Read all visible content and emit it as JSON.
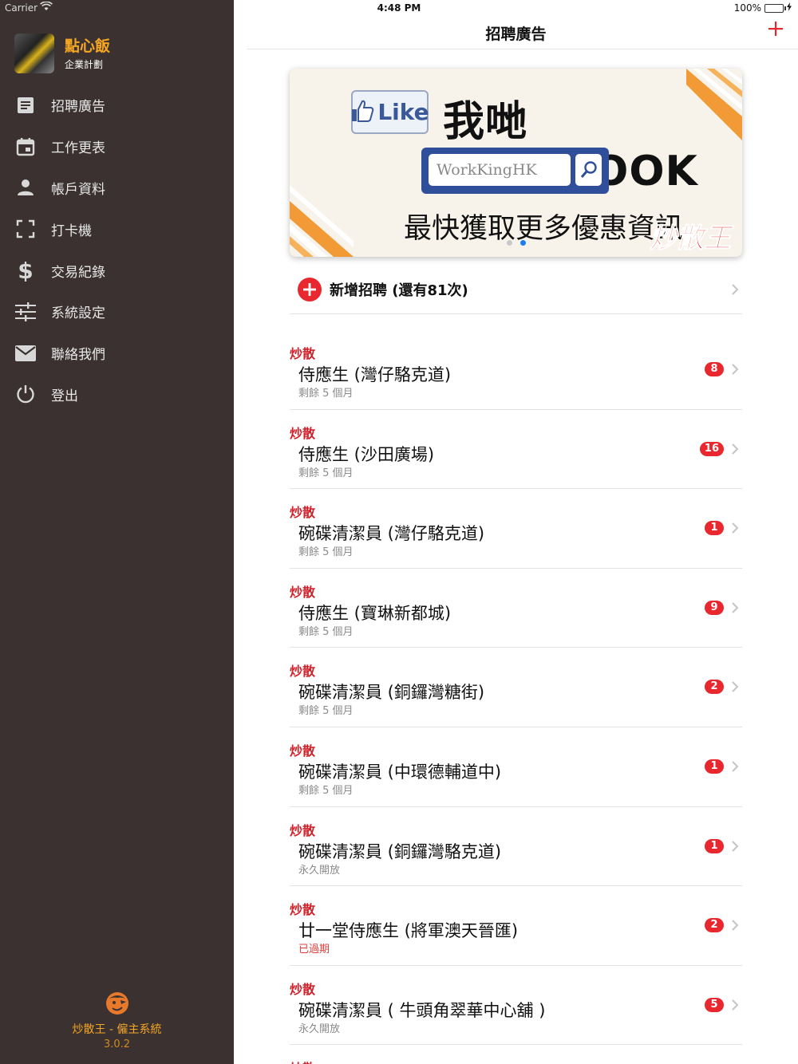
{
  "status_bar": {
    "carrier": "Carrier",
    "time": "4:48 PM",
    "battery": "100%",
    "battery_level": 1.0
  },
  "sidebar": {
    "profile": {
      "name": "點心飯",
      "plan": "企業計劃"
    },
    "items": [
      {
        "label": "招聘廣告",
        "icon": "document-icon"
      },
      {
        "label": "工作更表",
        "icon": "calendar-icon"
      },
      {
        "label": "帳戶資料",
        "icon": "user-icon"
      },
      {
        "label": "打卡機",
        "icon": "scan-icon"
      },
      {
        "label": "交易紀錄",
        "icon": "dollar-icon"
      },
      {
        "label": "系統設定",
        "icon": "sliders-icon"
      },
      {
        "label": "聯絡我們",
        "icon": "mail-icon"
      },
      {
        "label": "登出",
        "icon": "power-icon"
      }
    ],
    "brand": {
      "name": "炒散王 - 僱主系統",
      "version": "3.0.2"
    }
  },
  "navbar": {
    "title": "招聘廣告",
    "add_icon": "plus-icon"
  },
  "banner": {
    "like_label": "Like",
    "headline": "我哋 FACEBOOK",
    "search_text": "WorkKingHK",
    "slogan": "最快獲取更多優惠資訊",
    "logo_text": "炒散王",
    "page_count": 2,
    "active_page": 2
  },
  "add_row": {
    "label": "新增招聘 (還有81次)"
  },
  "jobs": [
    {
      "tag": "炒散",
      "title": "侍應生 (灣仔駱克道)",
      "sub": "剩餘 5 個月",
      "count": "8",
      "expired": false
    },
    {
      "tag": "炒散",
      "title": "侍應生 (沙田廣場)",
      "sub": "剩餘 5 個月",
      "count": "16",
      "expired": false
    },
    {
      "tag": "炒散",
      "title": "碗碟清潔員 (灣仔駱克道)",
      "sub": "剩餘 5 個月",
      "count": "1",
      "expired": false
    },
    {
      "tag": "炒散",
      "title": "侍應生 (寶琳新都城)",
      "sub": "剩餘 5 個月",
      "count": "9",
      "expired": false
    },
    {
      "tag": "炒散",
      "title": "碗碟清潔員 (銅鑼灣糖街)",
      "sub": "剩餘 5 個月",
      "count": "2",
      "expired": false
    },
    {
      "tag": "炒散",
      "title": "碗碟清潔員 (中環德輔道中)",
      "sub": "剩餘 5 個月",
      "count": "1",
      "expired": false
    },
    {
      "tag": "炒散",
      "title": "碗碟清潔員 (銅鑼灣駱克道)",
      "sub": "永久開放",
      "count": "1",
      "expired": false
    },
    {
      "tag": "炒散",
      "title": "廿一堂侍應生 (將軍澳天晉匯)",
      "sub": "已過期",
      "count": "2",
      "expired": true
    },
    {
      "tag": "炒散",
      "title": "碗碟清潔員 ( 牛頭角翠華中心舖 )",
      "sub": "永久開放",
      "count": "5",
      "expired": false
    },
    {
      "tag": "炒散"
    }
  ],
  "colors": {
    "sidebar_bg": "#3a3130",
    "accent_orange": "#f5a623",
    "accent_red": "#e8272f",
    "tag_red": "#d0212a"
  }
}
